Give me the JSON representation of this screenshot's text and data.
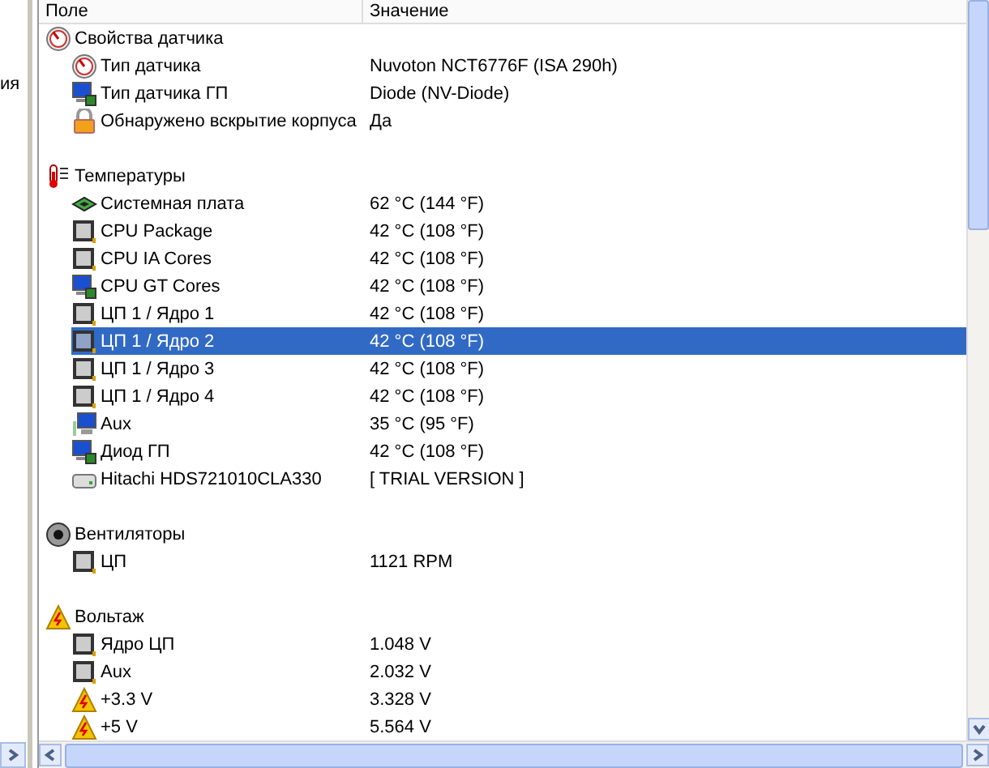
{
  "left_pane": {
    "text": "ия"
  },
  "table": {
    "columns": [
      "Поле",
      "Значение"
    ],
    "groups": [
      {
        "title": "Свойства датчика",
        "kind": "gauge",
        "items": [
          {
            "name": "Тип датчика",
            "value": "Nuvoton NCT6776F  (ISA 290h)",
            "kind": "gauge",
            "selected": false
          },
          {
            "name": "Тип датчика ГП",
            "value": "Diode  (NV-Diode)",
            "kind": "gpu",
            "selected": false
          },
          {
            "name": "Обнаружено вскрытие корпуса",
            "value": "Да",
            "kind": "lock",
            "selected": false
          }
        ]
      },
      {
        "title": "Температуры",
        "kind": "thermometer",
        "items": [
          {
            "name": "Системная плата",
            "value": "62 °C  (144 °F)",
            "kind": "board",
            "selected": false
          },
          {
            "name": "CPU Package",
            "value": "42 °C  (108 °F)",
            "kind": "chip",
            "selected": false
          },
          {
            "name": "CPU IA Cores",
            "value": "42 °C  (108 °F)",
            "kind": "chip",
            "selected": false
          },
          {
            "name": "CPU GT Cores",
            "value": "42 °C  (108 °F)",
            "kind": "gpu",
            "selected": false
          },
          {
            "name": "ЦП 1 / Ядро 1",
            "value": "42 °C  (108 °F)",
            "kind": "chip",
            "selected": false
          },
          {
            "name": "ЦП 1 / Ядро 2",
            "value": "42 °C  (108 °F)",
            "kind": "chip",
            "selected": true
          },
          {
            "name": "ЦП 1 / Ядро 3",
            "value": "42 °C  (108 °F)",
            "kind": "chip",
            "selected": false
          },
          {
            "name": "ЦП 1 / Ядро 4",
            "value": "42 °C  (108 °F)",
            "kind": "chip",
            "selected": false
          },
          {
            "name": "Aux",
            "value": "35 °C  (95 °F)",
            "kind": "monitor",
            "selected": false
          },
          {
            "name": "Диод ГП",
            "value": "42 °C  (108 °F)",
            "kind": "gpu",
            "selected": false
          },
          {
            "name": "Hitachi HDS721010CLA330",
            "value": "[ TRIAL VERSION ]",
            "kind": "drive",
            "selected": false
          }
        ]
      },
      {
        "title": "Вентиляторы",
        "kind": "fan",
        "items": [
          {
            "name": "ЦП",
            "value": "1121 RPM",
            "kind": "chip",
            "selected": false
          }
        ]
      },
      {
        "title": "Вольтаж",
        "kind": "warning",
        "items": [
          {
            "name": "Ядро ЦП",
            "value": "1.048 V",
            "kind": "chip",
            "selected": false
          },
          {
            "name": "Aux",
            "value": "2.032 V",
            "kind": "chip",
            "selected": false
          },
          {
            "name": "+3.3 V",
            "value": "3.328 V",
            "kind": "warning",
            "selected": false
          },
          {
            "name": "+5 V",
            "value": "5.564 V",
            "kind": "warning",
            "selected": false
          }
        ]
      }
    ]
  }
}
